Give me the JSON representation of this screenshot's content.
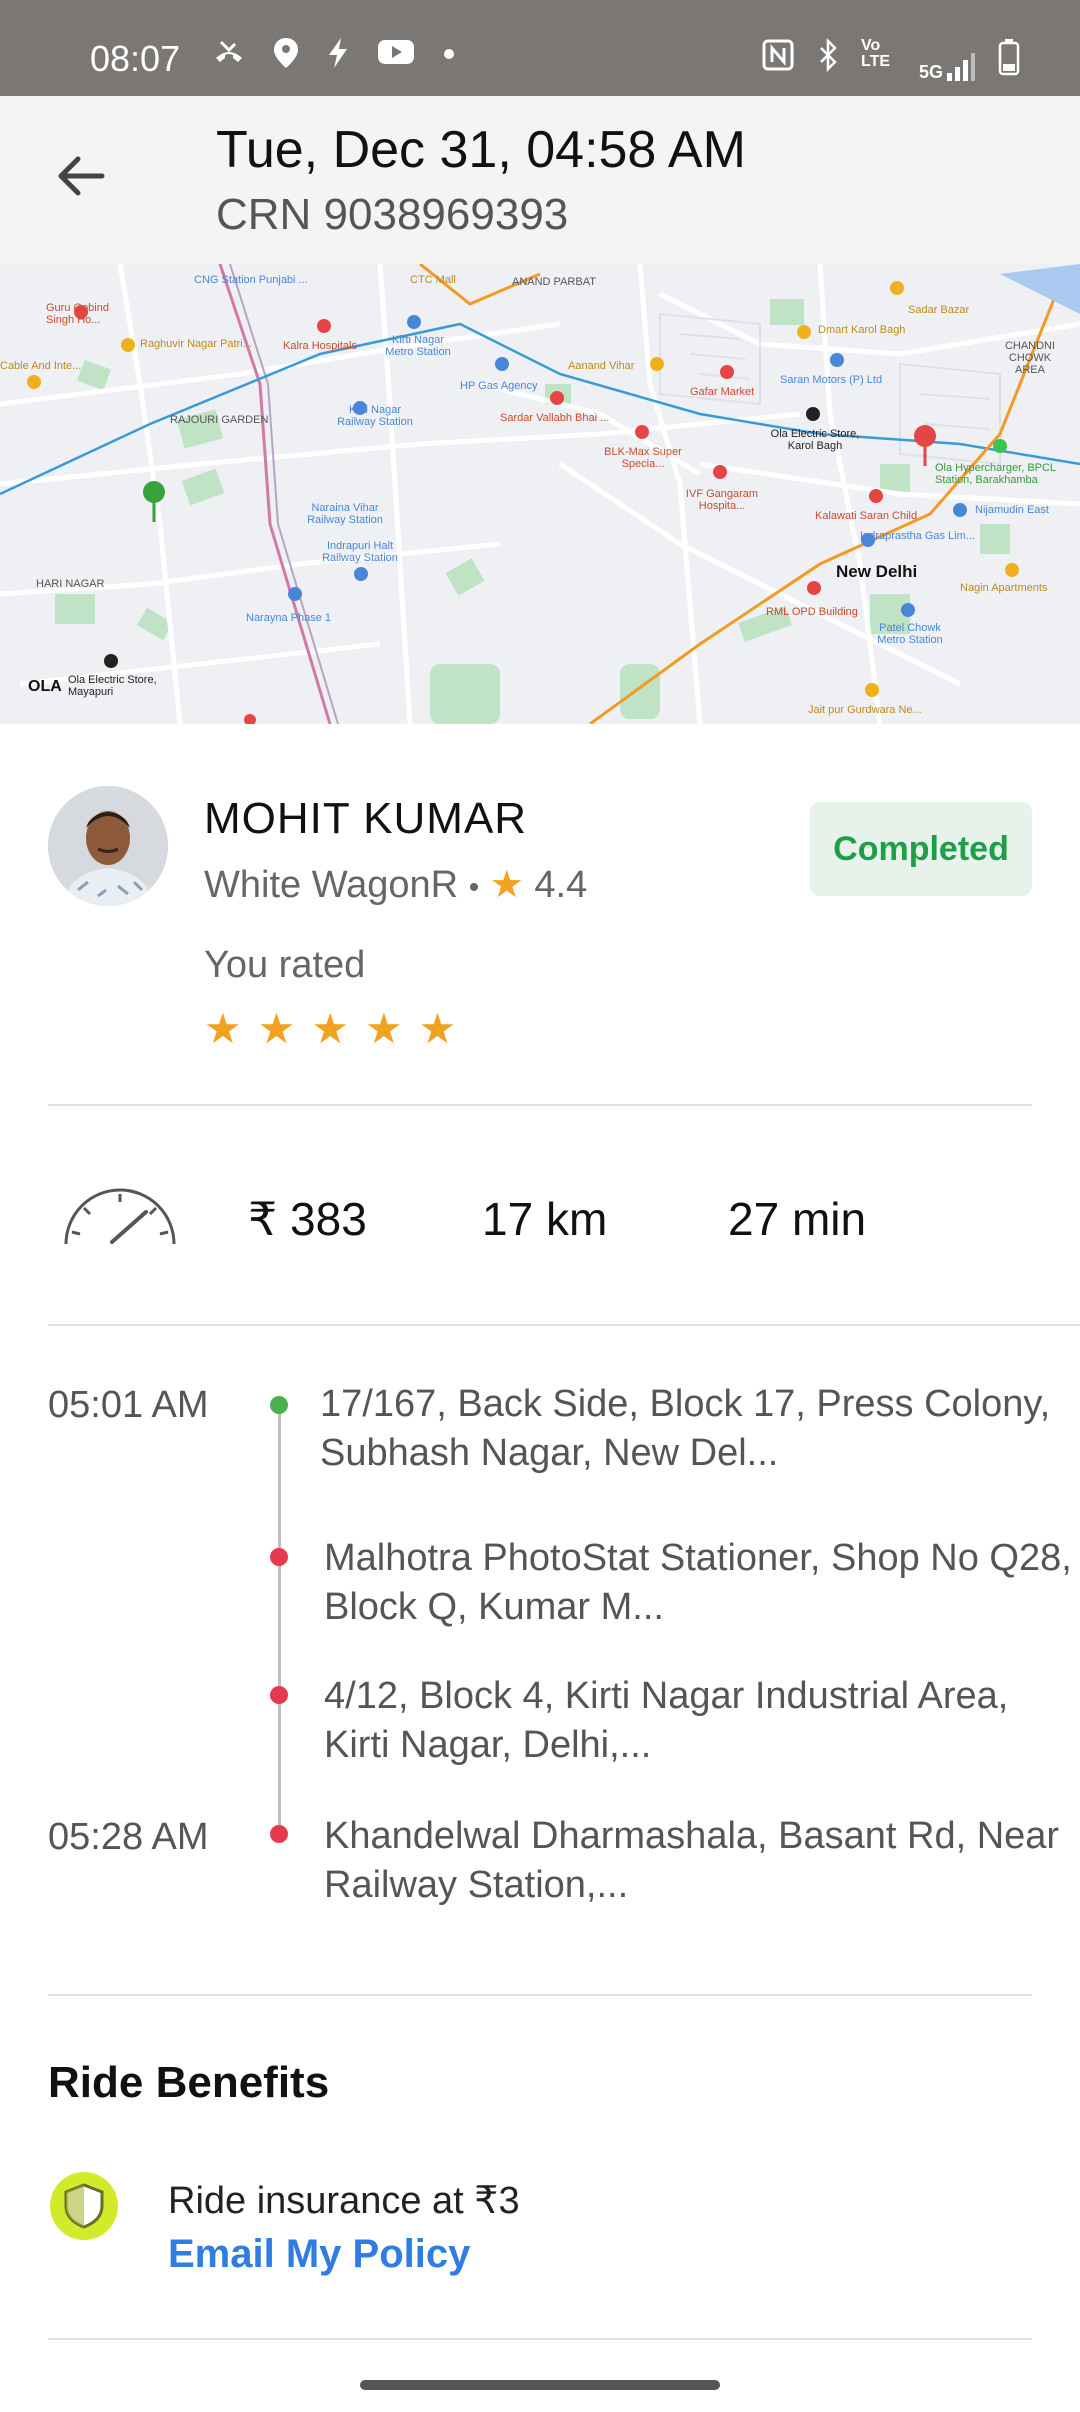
{
  "status_bar": {
    "time": "08:07",
    "icons_left": [
      "missed-call-icon",
      "location-icon",
      "bolt-icon",
      "youtube-icon",
      "dot-icon"
    ],
    "icons_right": [
      "nfc-icon",
      "bluetooth-icon",
      "volte-icon",
      "5g-signal-icon",
      "battery-icon"
    ],
    "network": "5G",
    "volte": "Vo LTE"
  },
  "header": {
    "title": "Tue, Dec 31, 04:58 AM",
    "crn": "CRN 9038969393"
  },
  "map": {
    "labels": [
      "Guru Gobind Singh Ho...",
      "CNG Station Punjabi ...",
      "CTC Mall",
      "ANAND PARBAT",
      "Sadar Bazar",
      "Dmart Karol Bagh",
      "CHANDNI CHOWK AREA",
      "Raghuvir Nagar Patri...",
      "Kalra Hospitals",
      "Kirti Nagar Metro Station",
      "Aanand Vihar",
      "Saran Motors (P) Ltd",
      "Cable And Inte...",
      "HP Gas Agency",
      "Gafar Market",
      "RAJOURI GARDEN",
      "Kirti Nagar Railway Station",
      "Sardar Vallabh Bhai ...",
      "Ola Electric Store, Karol Bagh",
      "BLK-Max Super Specia...",
      "Ola Hypercharger, BPCL Station, Barakhamba",
      "Naraina Vihar Railway Station",
      "IVF Gangaram Hospita...",
      "Kalawati Saran Child",
      "Nijamudin East",
      "Indraprastha Gas Lim...",
      "Indrapuri Halt Railway Station",
      "HARI NAGAR",
      "New Delhi",
      "Nagin Apartments",
      "Narayna Phase 1",
      "RML OPD Building",
      "Patel Chowk Metro Station",
      "Ola Electric Store, Mayapuri",
      "Jait pur Gurdwara Ne..."
    ],
    "accent_colors": {
      "green": "#3aa13f",
      "red": "#e54545",
      "water": "#a9c9f0",
      "park": "#bfe3c4"
    }
  },
  "driver": {
    "name": "MOHIT KUMAR",
    "car": "White WagonR",
    "separator": "•",
    "rating_icon": "★",
    "rating": "4.4",
    "status": "Completed",
    "you_rated_label": "You rated",
    "user_rating": 5,
    "star_glyph": "★"
  },
  "stats": {
    "fare": "₹ 383",
    "distance": "17 km",
    "duration": "27 min"
  },
  "timeline": [
    {
      "time": "05:01 AM",
      "address": "17/167, Back Side, Block 17, Press Colony, Subhash Nagar, New Del...",
      "type": "pickup",
      "color": "#4caf50"
    },
    {
      "time": "",
      "address": "Malhotra PhotoStat Stationer, Shop No Q28, Block Q, Kumar M...",
      "type": "stop",
      "color": "#e53950"
    },
    {
      "time": "",
      "address": "4/12, Block 4, Kirti Nagar Industrial Area, Kirti Nagar, Delhi,...",
      "type": "stop",
      "color": "#e53950"
    },
    {
      "time": "05:28 AM",
      "address": "Khandelwal Dharmashala, Basant Rd, Near Railway Station,...",
      "type": "drop",
      "color": "#e53950"
    }
  ],
  "benefits": {
    "title": "Ride Benefits",
    "insurance_text": "Ride insurance at ₹3",
    "policy_link": "Email My Policy"
  }
}
